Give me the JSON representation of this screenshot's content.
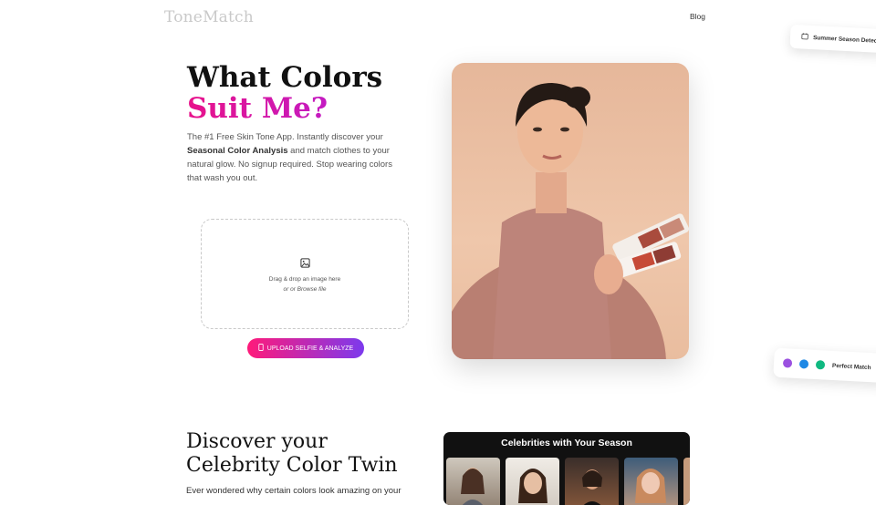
{
  "header": {
    "logo": "ToneMatch",
    "nav": {
      "blog": "Blog"
    }
  },
  "toasts": {
    "season": "Summer Season Detected",
    "match": "Perfect Match",
    "match_dots": [
      "#9b51e0",
      "#1e88e5",
      "#10b981"
    ]
  },
  "hero": {
    "title_line1": "What Colors",
    "title_line2": "Suit Me?",
    "desc_part1": "The #1 Free Skin Tone App. Instantly discover your",
    "desc_bold": "Seasonal Color Analysis",
    "desc_part2": "and match clothes to your natural glow. No signup required. Stop wearing colors that wash you out."
  },
  "upload": {
    "drop_text": "Drag & drop an image here",
    "browse_text": "or or Browse file",
    "button_label": "UPLOAD SELFIE & ANALYZE"
  },
  "section2": {
    "title": "Discover your Celebrity Color Twin",
    "desc": "Ever wondered why certain colors look amazing on your",
    "panel_title": "Celebrities with Your Season"
  },
  "colors": {
    "accent_pink": "#e8128a",
    "accent_purple": "#7c3aed"
  }
}
